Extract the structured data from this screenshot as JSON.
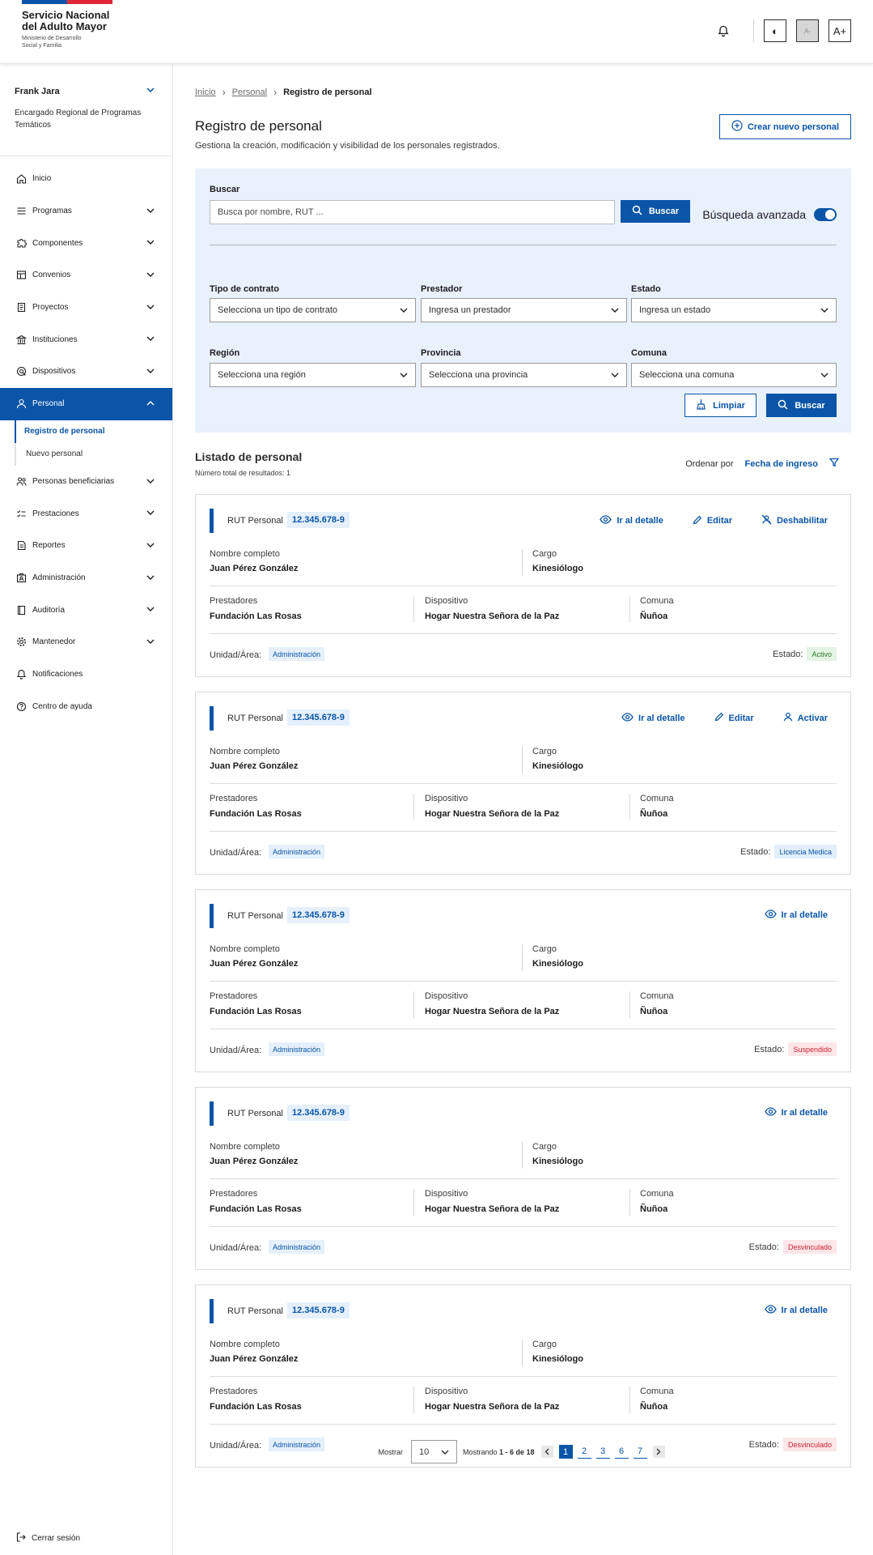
{
  "header": {
    "logo_title_line1": "Servicio Nacional",
    "logo_title_line2": "del Adulto Mayor",
    "logo_sub": "Ministerio de Desarrollo Social y Familia",
    "btn_contrast": "◐",
    "btn_font_decrease": "A-",
    "btn_font_increase": "A+"
  },
  "user": {
    "name": "Frank Jara",
    "role": "Encargado Regional de Programas Temáticos"
  },
  "sidebar": {
    "items": [
      {
        "label": "Inicio",
        "icon": "home-icon",
        "has_chevron": false
      },
      {
        "label": "Programas",
        "icon": "list-icon",
        "has_chevron": true
      },
      {
        "label": "Componentes",
        "icon": "puzzle-icon",
        "has_chevron": true
      },
      {
        "label": "Convenios",
        "icon": "agreement-icon",
        "has_chevron": true
      },
      {
        "label": "Proyectos",
        "icon": "document-icon",
        "has_chevron": true
      },
      {
        "label": "Instituciones",
        "icon": "institution-icon",
        "has_chevron": true
      },
      {
        "label": "Dispositivos",
        "icon": "device-icon",
        "has_chevron": true
      },
      {
        "label": "Personal",
        "icon": "person-icon",
        "has_chevron": true,
        "active": true
      },
      {
        "label": "Personas beneficiarias",
        "icon": "people-icon",
        "has_chevron": true
      },
      {
        "label": "Prestaciones",
        "icon": "checklist-icon",
        "has_chevron": true
      },
      {
        "label": "Reportes",
        "icon": "report-icon",
        "has_chevron": true
      },
      {
        "label": "Administración",
        "icon": "admin-icon",
        "has_chevron": true
      },
      {
        "label": "Auditoría",
        "icon": "audit-icon",
        "has_chevron": true
      },
      {
        "label": "Mantenedor",
        "icon": "gear-icon",
        "has_chevron": true
      },
      {
        "label": "Notificaciones",
        "icon": "bell-icon",
        "has_chevron": false
      },
      {
        "label": "Centro de ayuda",
        "icon": "help-icon",
        "has_chevron": false
      }
    ],
    "sub_items": [
      "Registro de personal",
      "Nuevo personal"
    ],
    "logout": "Cerrar sesión"
  },
  "breadcrumb": {
    "home": "Inicio",
    "section": "Personal",
    "current": "Registro de personal"
  },
  "page": {
    "title": "Registro de personal",
    "subtitle": "Gestiona la creación, modificación y visibilidad de los personales registrados.",
    "create_button": "Crear nuevo personal"
  },
  "filters": {
    "search_label": "Buscar",
    "search_placeholder": "Busca por nombre, RUT ...",
    "search_button": "Buscar",
    "advanced_label": "Búsqueda avanzada",
    "fields": [
      {
        "label": "Tipo de contrato",
        "value": "Selecciona un tipo de contrato"
      },
      {
        "label": "Prestador",
        "value": "Ingresa un prestador"
      },
      {
        "label": "Estado",
        "value": "Ingresa un estado"
      },
      {
        "label": "Región",
        "value": "Selecciona una región"
      },
      {
        "label": "Provincia",
        "value": "Selecciona una provincia"
      },
      {
        "label": "Comuna",
        "value": "Selecciona una comuna"
      }
    ],
    "clear_button": "Limpiar",
    "apply_button": "Buscar"
  },
  "list": {
    "title": "Listado de personal",
    "count": "Número total de resultados: 1",
    "order_label": "Ordenar por",
    "order_value": "Fecha de ingreso"
  },
  "labels": {
    "rut": "RUT Personal",
    "name": "Nombre completo",
    "cargo": "Cargo",
    "prestadores": "Prestadores",
    "dispositivo": "Dispositivo",
    "comuna": "Comuna",
    "unidad": "Unidad/Área:",
    "estado": "Estado:",
    "detail": "Ir al detalle",
    "edit": "Editar",
    "disable": "Deshabilitar",
    "activate": "Activar"
  },
  "cards": [
    {
      "rut": "12.345.678-9",
      "name": "Juan Pérez González",
      "cargo": "Kinesiólogo",
      "prestadores": "Fundación Las Rosas",
      "dispositivo": "Hogar Nuestra Señora de la Paz",
      "comuna": "Ñuñoa",
      "unidad": "Administración",
      "estado": "Activo",
      "estado_bg": "#e4f4e4",
      "estado_fg": "#2a7a2a",
      "actions": [
        "detail",
        "edit",
        "disable"
      ]
    },
    {
      "rut": "12.345.678-9",
      "name": "Juan Pérez González",
      "cargo": "Kinesiólogo",
      "prestadores": "Fundación Las Rosas",
      "dispositivo": "Hogar Nuestra Señora de la Paz",
      "comuna": "Ñuñoa",
      "unidad": "Administración",
      "estado": "Licencia Medica",
      "estado_bg": "#e2effb",
      "estado_fg": "#0a55a8",
      "actions": [
        "detail",
        "edit",
        "activate"
      ]
    },
    {
      "rut": "12.345.678-9",
      "name": "Juan Pérez González",
      "cargo": "Kinesiólogo",
      "prestadores": "Fundación Las Rosas",
      "dispositivo": "Hogar Nuestra Señora de la Paz",
      "comuna": "Ñuñoa",
      "unidad": "Administración",
      "estado": "Suspendido",
      "estado_bg": "#fde6e8",
      "estado_fg": "#cc2233",
      "actions": [
        "detail"
      ]
    },
    {
      "rut": "12.345.678-9",
      "name": "Juan Pérez González",
      "cargo": "Kinesiólogo",
      "prestadores": "Fundación Las Rosas",
      "dispositivo": "Hogar Nuestra Señora de la Paz",
      "comuna": "Ñuñoa",
      "unidad": "Administración",
      "estado": "Desvinculado",
      "estado_bg": "#fde6e8",
      "estado_fg": "#cc2233",
      "actions": [
        "detail"
      ]
    },
    {
      "rut": "12.345.678-9",
      "name": "Juan Pérez González",
      "cargo": "Kinesiólogo",
      "prestadores": "Fundación Las Rosas",
      "dispositivo": "Hogar Nuestra Señora de la Paz",
      "comuna": "Ñuñoa",
      "unidad": "Administración",
      "estado": "Desvinculado",
      "estado_bg": "#fde6e8",
      "estado_fg": "#cc2233",
      "actions": [
        "detail"
      ]
    }
  ],
  "pagination": {
    "show_label": "Mostrar",
    "page_size": "10",
    "range_prefix": "Mostrando",
    "range_bold": "1 - 6 de 18",
    "pages": [
      "1",
      "2",
      "3",
      "6",
      "7"
    ],
    "current": "1"
  },
  "colors": {
    "primary": "#0a55a8",
    "panel_bg": "#e8f1fc"
  }
}
